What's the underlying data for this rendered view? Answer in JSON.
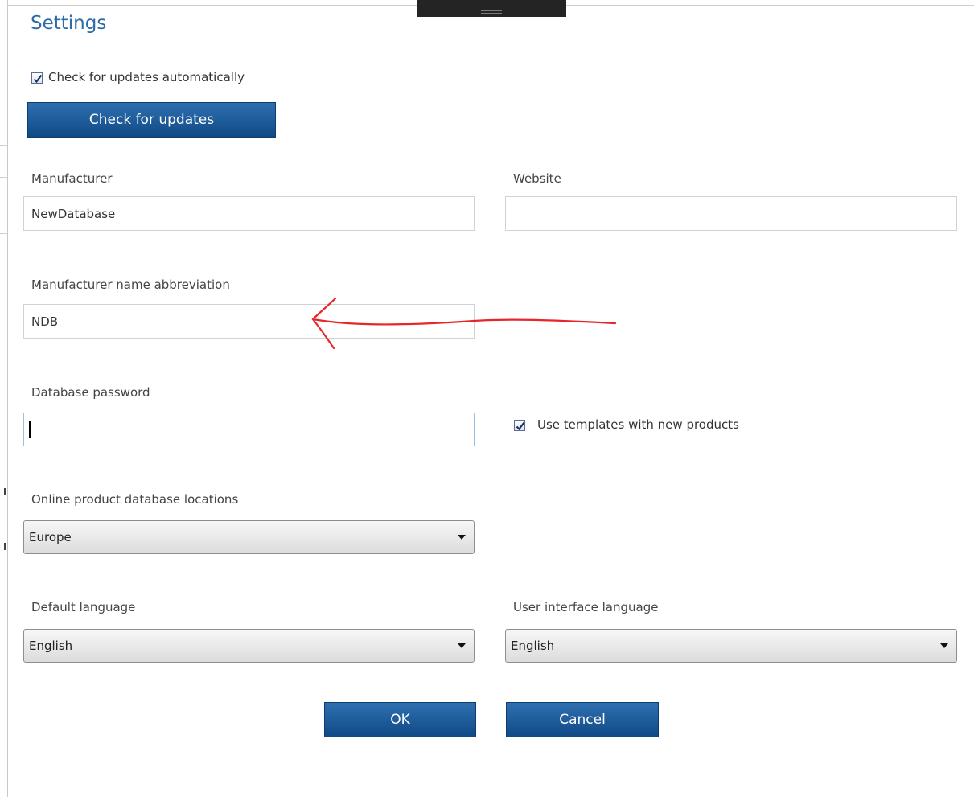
{
  "dialog": {
    "title": "Settings"
  },
  "updates": {
    "auto_check_label": "Check for updates automatically",
    "auto_check_checked": true,
    "check_button_label": "Check for updates"
  },
  "manufacturer": {
    "label": "Manufacturer",
    "value": "NewDatabase"
  },
  "website": {
    "label": "Website",
    "value": ""
  },
  "abbreviation": {
    "label": "Manufacturer name abbreviation",
    "value": "NDB"
  },
  "password": {
    "label": "Database password",
    "value": ""
  },
  "templates": {
    "label": "Use templates with new products",
    "checked": true
  },
  "locations": {
    "label": "Online product database locations",
    "selected": "Europe"
  },
  "default_language": {
    "label": "Default language",
    "selected": "English"
  },
  "ui_language": {
    "label": "User interface language",
    "selected": "English"
  },
  "actions": {
    "ok_label": "OK",
    "cancel_label": "Cancel"
  },
  "colors": {
    "title": "#2e6ca8",
    "button": "#1a5a9a",
    "annotation": "#e8262a"
  },
  "icons": {
    "checkbox": "checkmark-icon",
    "select_arrow": "triangle-down-icon",
    "annotation": "red-arrow-annotation"
  }
}
